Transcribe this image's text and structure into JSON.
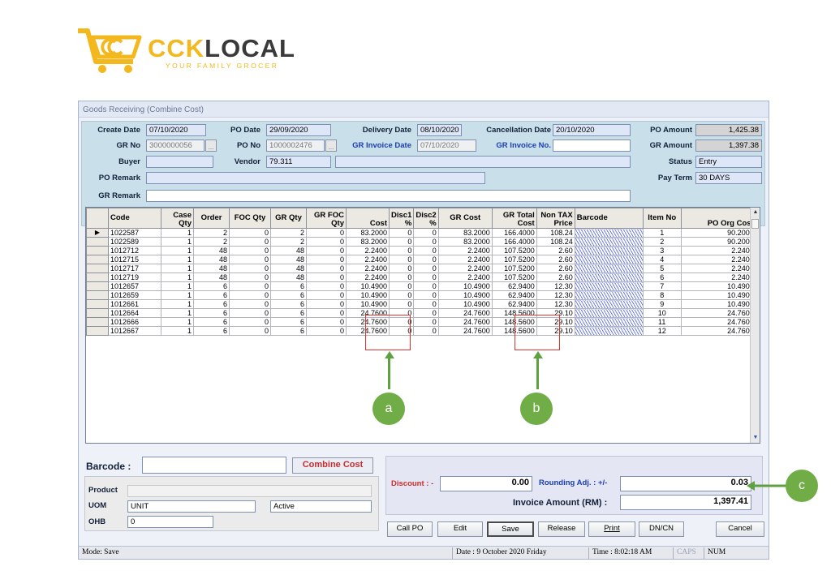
{
  "brand": {
    "name_a": "CCK",
    "name_b": "LOCAL",
    "tagline": "YOUR FAMILY GROCER"
  },
  "window": {
    "title": "Goods Receiving (Combine Cost)"
  },
  "header": {
    "create_date_label": "Create Date",
    "create_date": "07/10/2020",
    "po_date_label": "PO Date",
    "po_date": "29/09/2020",
    "delivery_date_label": "Delivery Date",
    "delivery_date": "08/10/2020",
    "cancellation_date_label": "Cancellation Date",
    "cancellation_date": "20/10/2020",
    "po_amount_label": "PO Amount",
    "po_amount": "1,425.38",
    "gr_no_label": "GR No",
    "gr_no": "3000000056",
    "po_no_label": "PO No",
    "po_no": "1000002476",
    "gr_invoice_date_label": "GR Invoice Date",
    "gr_invoice_date": "07/10/2020",
    "gr_invoice_no_label": "GR Invoice No.",
    "gr_invoice_no": "",
    "gr_amount_label": "GR Amount",
    "gr_amount": "1,397.38",
    "buyer_label": "Buyer",
    "buyer": "",
    "vendor_label": "Vendor",
    "vendor_code": "79.311",
    "vendor_name": "",
    "status_label": "Status",
    "status": "Entry",
    "po_remark_label": "PO Remark",
    "po_remark": "",
    "pay_term_label": "Pay Term",
    "pay_term": "30 DAYS",
    "gr_remark_label": "GR Remark",
    "gr_remark": "",
    "lookup_glyph": "..."
  },
  "grid": {
    "columns": [
      "Code",
      "Case Qty",
      "Order",
      "FOC Qty",
      "GR Qty",
      "GR FOC Qty",
      "Cost",
      "Disc1 %",
      "Disc2 %",
      "GR Cost",
      "GR Total Cost",
      "Non TAX Price",
      "Barcode",
      "Item No",
      "PO Org Cost"
    ],
    "rows": [
      [
        "1022587",
        "1",
        "2",
        "0",
        "2",
        "0",
        "83.2000",
        "0",
        "0",
        "83.2000",
        "166.4000",
        "108.24",
        "",
        "1",
        "90.2000"
      ],
      [
        "1022589",
        "1",
        "2",
        "0",
        "2",
        "0",
        "83.2000",
        "0",
        "0",
        "83.2000",
        "166.4000",
        "108.24",
        "",
        "2",
        "90.2000"
      ],
      [
        "1012712",
        "1",
        "48",
        "0",
        "48",
        "0",
        "2.2400",
        "0",
        "0",
        "2.2400",
        "107.5200",
        "2.60",
        "",
        "3",
        "2.2400"
      ],
      [
        "1012715",
        "1",
        "48",
        "0",
        "48",
        "0",
        "2.2400",
        "0",
        "0",
        "2.2400",
        "107.5200",
        "2.60",
        "",
        "4",
        "2.2400"
      ],
      [
        "1012717",
        "1",
        "48",
        "0",
        "48",
        "0",
        "2.2400",
        "0",
        "0",
        "2.2400",
        "107.5200",
        "2.60",
        "",
        "5",
        "2.2400"
      ],
      [
        "1012719",
        "1",
        "48",
        "0",
        "48",
        "0",
        "2.2400",
        "0",
        "0",
        "2.2400",
        "107.5200",
        "2.60",
        "",
        "6",
        "2.2400"
      ],
      [
        "1012657",
        "1",
        "6",
        "0",
        "6",
        "0",
        "10.4900",
        "0",
        "0",
        "10.4900",
        "62.9400",
        "12.30",
        "",
        "7",
        "10.4900"
      ],
      [
        "1012659",
        "1",
        "6",
        "0",
        "6",
        "0",
        "10.4900",
        "0",
        "0",
        "10.4900",
        "62.9400",
        "12.30",
        "",
        "8",
        "10.4900"
      ],
      [
        "1012661",
        "1",
        "6",
        "0",
        "6",
        "0",
        "10.4900",
        "0",
        "0",
        "10.4900",
        "62.9400",
        "12.30",
        "",
        "9",
        "10.4900"
      ],
      [
        "1012664",
        "1",
        "6",
        "0",
        "6",
        "0",
        "24.7600",
        "0",
        "0",
        "24.7600",
        "148.5600",
        "29.10",
        "",
        "10",
        "24.7600"
      ],
      [
        "1012666",
        "1",
        "6",
        "0",
        "6",
        "0",
        "24.7600",
        "0",
        "0",
        "24.7600",
        "148.5600",
        "29.10",
        "",
        "11",
        "24.7600"
      ],
      [
        "1012667",
        "1",
        "6",
        "0",
        "6",
        "0",
        "24.7600",
        "0",
        "0",
        "24.7600",
        "148.5600",
        "29.10",
        "",
        "12",
        "24.7600"
      ]
    ],
    "current_row_glyph": "▶",
    "scroll_up_glyph": "▲",
    "scroll_down_glyph": "▼"
  },
  "annotations": {
    "a": "a",
    "b": "b",
    "c": "c"
  },
  "bottom": {
    "barcode_label": "Barcode :",
    "barcode_value": "",
    "combine_cost_button": "Combine Cost",
    "product_label": "Product",
    "product_value": "",
    "uom_label": "UOM",
    "uom_value": "UNIT",
    "active_value": "Active",
    "ohb_label": "OHB",
    "ohb_value": "0",
    "discount_label": "Discount : -",
    "discount_value": "0.00",
    "rounding_label": "Rounding Adj. : +/-",
    "rounding_value": "0.03",
    "invoice_amount_label": "Invoice Amount (RM) :",
    "invoice_amount_value": "1,397.41"
  },
  "buttons": {
    "call_po": "Call PO",
    "edit": "Edit",
    "save": "Save",
    "release": "Release",
    "print": "Print",
    "dncn": "DN/CN",
    "cancel": "Cancel"
  },
  "status_bar": {
    "mode": "Mode: Save",
    "date": "Date : 9  October  2020  Friday",
    "time": "Time : 8:02:18 AM",
    "caps": "CAPS",
    "num": "NUM"
  },
  "colors": {
    "logo_yellow": "#f4b81f",
    "highlight_red": "#e0322e",
    "annotation_green": "#70ad47"
  }
}
